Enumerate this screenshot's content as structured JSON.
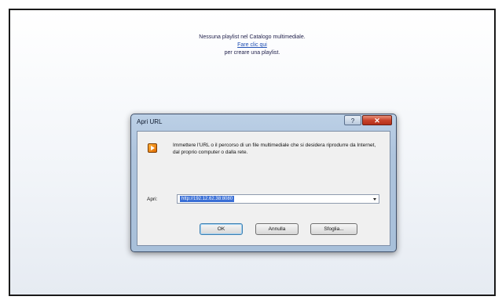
{
  "library": {
    "line1": "Nessuna playlist nel Catalogo multimediale.",
    "link": "Fare clic qui",
    "line3": "per creare una playlist."
  },
  "dialog": {
    "title": "Apri URL",
    "help_glyph": "?",
    "close_glyph": "✕",
    "instruction": "Immettere l'URL o il percorso di un file multimediale che si desidera riprodurre da Internet, dal proprio computer o dalla rete.",
    "open_label": "Apri:",
    "url_value": "http://192.12.62.38:8080",
    "buttons": {
      "ok": "OK",
      "cancel": "Annulla",
      "browse": "Sfoglia..."
    }
  },
  "icons": {
    "app": "media-player-icon",
    "combo": "chevron-down-icon"
  },
  "colors": {
    "accent": "#3a6fd6",
    "close": "#c8432b",
    "link": "#1f4fb3"
  }
}
